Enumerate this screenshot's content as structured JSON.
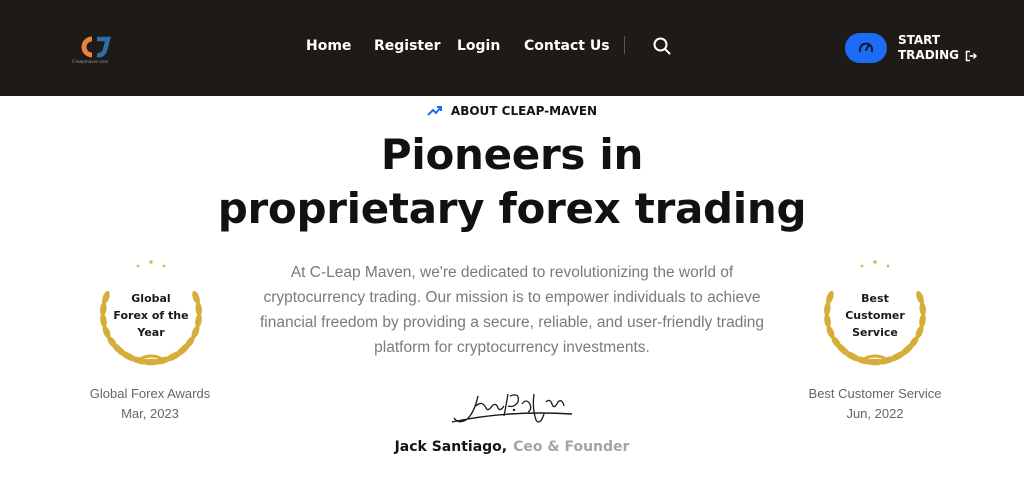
{
  "header": {
    "logo": {
      "caption": "C-leapmaven.com",
      "icon": "cj-logo-icon"
    },
    "nav": [
      {
        "label": "Home"
      },
      {
        "label": "Register"
      },
      {
        "label": "Login"
      },
      {
        "label": "Contact Us"
      }
    ],
    "search_icon": "search-icon",
    "gauge_icon": "speedometer-icon",
    "start_button": {
      "line1": "START",
      "line2": "TRADING",
      "icon": "sign-out-icon"
    }
  },
  "hero": {
    "eyebrow": "ABOUT CLEAP-MAVEN",
    "eyebrow_icon": "trend-up-icon",
    "headline_line1": "Pioneers in",
    "headline_line2": "proprietary forex trading",
    "intro": "At C-Leap Maven, we're dedicated to revolutionizing the world of cryptocurrency trading. Our mission is to empower individuals to achieve financial freedom by providing a secure, reliable, and user-friendly trading platform for cryptocurrency investments."
  },
  "awards": [
    {
      "title_lines": [
        "Global",
        "Forex of the",
        "Year"
      ],
      "caption": "Global Forex Awards",
      "date": "Mar, 2023"
    },
    {
      "title_lines": [
        "Best",
        "Customer",
        "Service"
      ],
      "caption": "Best Customer Service",
      "date": "Jun, 2022"
    }
  ],
  "founder": {
    "name": "Jack Santiago,",
    "role": "Ceo & Founder"
  },
  "colors": {
    "header_bg": "#1d1a18",
    "accent_blue": "#1d6cf5",
    "laurel_gold": "#d7ad3a",
    "role_gray": "#a8a49a"
  }
}
